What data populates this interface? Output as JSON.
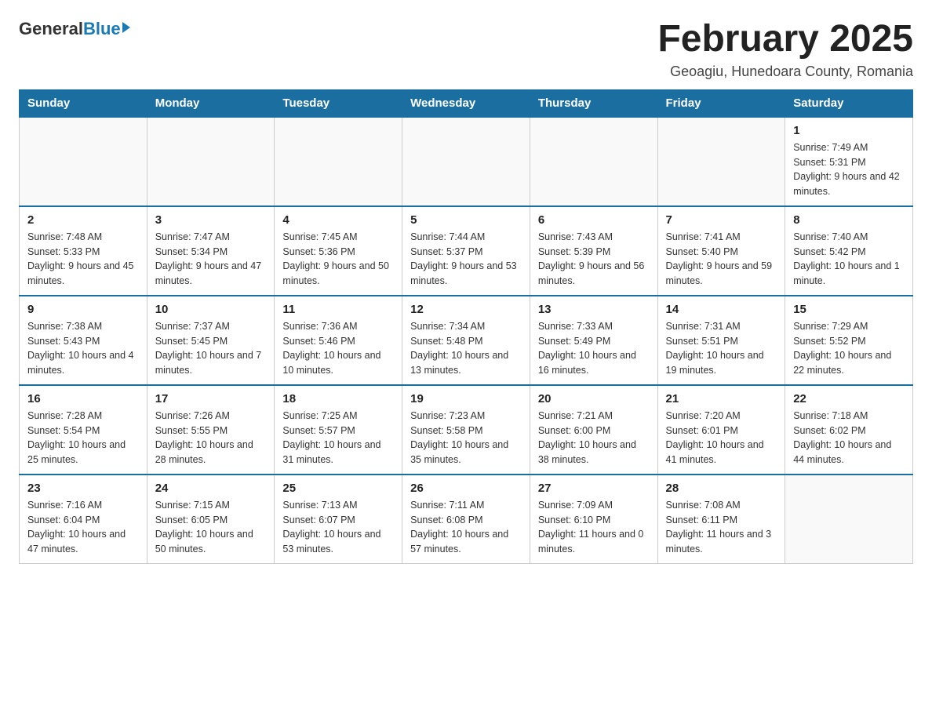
{
  "header": {
    "logo": {
      "general": "General",
      "blue": "Blue"
    },
    "title": "February 2025",
    "subtitle": "Geoagiu, Hunedoara County, Romania"
  },
  "weekdays": [
    "Sunday",
    "Monday",
    "Tuesday",
    "Wednesday",
    "Thursday",
    "Friday",
    "Saturday"
  ],
  "weeks": [
    [
      {
        "day": "",
        "info": ""
      },
      {
        "day": "",
        "info": ""
      },
      {
        "day": "",
        "info": ""
      },
      {
        "day": "",
        "info": ""
      },
      {
        "day": "",
        "info": ""
      },
      {
        "day": "",
        "info": ""
      },
      {
        "day": "1",
        "info": "Sunrise: 7:49 AM\nSunset: 5:31 PM\nDaylight: 9 hours and 42 minutes."
      }
    ],
    [
      {
        "day": "2",
        "info": "Sunrise: 7:48 AM\nSunset: 5:33 PM\nDaylight: 9 hours and 45 minutes."
      },
      {
        "day": "3",
        "info": "Sunrise: 7:47 AM\nSunset: 5:34 PM\nDaylight: 9 hours and 47 minutes."
      },
      {
        "day": "4",
        "info": "Sunrise: 7:45 AM\nSunset: 5:36 PM\nDaylight: 9 hours and 50 minutes."
      },
      {
        "day": "5",
        "info": "Sunrise: 7:44 AM\nSunset: 5:37 PM\nDaylight: 9 hours and 53 minutes."
      },
      {
        "day": "6",
        "info": "Sunrise: 7:43 AM\nSunset: 5:39 PM\nDaylight: 9 hours and 56 minutes."
      },
      {
        "day": "7",
        "info": "Sunrise: 7:41 AM\nSunset: 5:40 PM\nDaylight: 9 hours and 59 minutes."
      },
      {
        "day": "8",
        "info": "Sunrise: 7:40 AM\nSunset: 5:42 PM\nDaylight: 10 hours and 1 minute."
      }
    ],
    [
      {
        "day": "9",
        "info": "Sunrise: 7:38 AM\nSunset: 5:43 PM\nDaylight: 10 hours and 4 minutes."
      },
      {
        "day": "10",
        "info": "Sunrise: 7:37 AM\nSunset: 5:45 PM\nDaylight: 10 hours and 7 minutes."
      },
      {
        "day": "11",
        "info": "Sunrise: 7:36 AM\nSunset: 5:46 PM\nDaylight: 10 hours and 10 minutes."
      },
      {
        "day": "12",
        "info": "Sunrise: 7:34 AM\nSunset: 5:48 PM\nDaylight: 10 hours and 13 minutes."
      },
      {
        "day": "13",
        "info": "Sunrise: 7:33 AM\nSunset: 5:49 PM\nDaylight: 10 hours and 16 minutes."
      },
      {
        "day": "14",
        "info": "Sunrise: 7:31 AM\nSunset: 5:51 PM\nDaylight: 10 hours and 19 minutes."
      },
      {
        "day": "15",
        "info": "Sunrise: 7:29 AM\nSunset: 5:52 PM\nDaylight: 10 hours and 22 minutes."
      }
    ],
    [
      {
        "day": "16",
        "info": "Sunrise: 7:28 AM\nSunset: 5:54 PM\nDaylight: 10 hours and 25 minutes."
      },
      {
        "day": "17",
        "info": "Sunrise: 7:26 AM\nSunset: 5:55 PM\nDaylight: 10 hours and 28 minutes."
      },
      {
        "day": "18",
        "info": "Sunrise: 7:25 AM\nSunset: 5:57 PM\nDaylight: 10 hours and 31 minutes."
      },
      {
        "day": "19",
        "info": "Sunrise: 7:23 AM\nSunset: 5:58 PM\nDaylight: 10 hours and 35 minutes."
      },
      {
        "day": "20",
        "info": "Sunrise: 7:21 AM\nSunset: 6:00 PM\nDaylight: 10 hours and 38 minutes."
      },
      {
        "day": "21",
        "info": "Sunrise: 7:20 AM\nSunset: 6:01 PM\nDaylight: 10 hours and 41 minutes."
      },
      {
        "day": "22",
        "info": "Sunrise: 7:18 AM\nSunset: 6:02 PM\nDaylight: 10 hours and 44 minutes."
      }
    ],
    [
      {
        "day": "23",
        "info": "Sunrise: 7:16 AM\nSunset: 6:04 PM\nDaylight: 10 hours and 47 minutes."
      },
      {
        "day": "24",
        "info": "Sunrise: 7:15 AM\nSunset: 6:05 PM\nDaylight: 10 hours and 50 minutes."
      },
      {
        "day": "25",
        "info": "Sunrise: 7:13 AM\nSunset: 6:07 PM\nDaylight: 10 hours and 53 minutes."
      },
      {
        "day": "26",
        "info": "Sunrise: 7:11 AM\nSunset: 6:08 PM\nDaylight: 10 hours and 57 minutes."
      },
      {
        "day": "27",
        "info": "Sunrise: 7:09 AM\nSunset: 6:10 PM\nDaylight: 11 hours and 0 minutes."
      },
      {
        "day": "28",
        "info": "Sunrise: 7:08 AM\nSunset: 6:11 PM\nDaylight: 11 hours and 3 minutes."
      },
      {
        "day": "",
        "info": ""
      }
    ]
  ]
}
